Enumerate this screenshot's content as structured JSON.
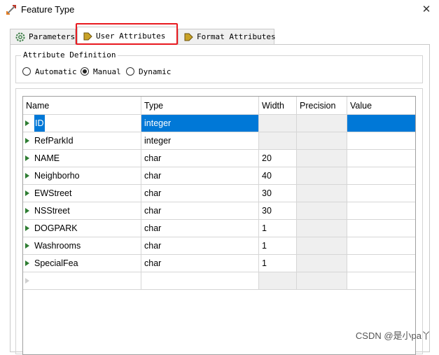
{
  "window": {
    "title": "Feature Type",
    "close_glyph": "✕",
    "title_icon": "feature-type-icon"
  },
  "tabs": [
    {
      "label": "Parameters",
      "icon": "gear-icon",
      "active": false
    },
    {
      "label": "User Attributes",
      "icon": "arrow-right-icon",
      "active": true
    },
    {
      "label": "Format Attributes",
      "icon": "arrow-right-icon",
      "active": false
    }
  ],
  "attribute_definition": {
    "title": "Attribute Definition",
    "options": [
      {
        "label": "Automatic",
        "selected": false
      },
      {
        "label": "Manual",
        "selected": true
      },
      {
        "label": "Dynamic",
        "selected": false
      }
    ]
  },
  "table": {
    "columns": [
      "Name",
      "Type",
      "Width",
      "Precision",
      "Value"
    ],
    "rows": [
      {
        "name": "ID",
        "type": "integer",
        "width": "",
        "precision": "",
        "value": ""
      },
      {
        "name": "RefParkId",
        "type": "integer",
        "width": "",
        "precision": "",
        "value": ""
      },
      {
        "name": "NAME",
        "type": "char",
        "width": "20",
        "precision": "",
        "value": ""
      },
      {
        "name": "Neighborho",
        "type": "char",
        "width": "40",
        "precision": "",
        "value": ""
      },
      {
        "name": "EWStreet",
        "type": "char",
        "width": "30",
        "precision": "",
        "value": ""
      },
      {
        "name": "NSStreet",
        "type": "char",
        "width": "30",
        "precision": "",
        "value": ""
      },
      {
        "name": "DOGPARK",
        "type": "char",
        "width": "1",
        "precision": "",
        "value": ""
      },
      {
        "name": "Washrooms",
        "type": "char",
        "width": "1",
        "precision": "",
        "value": ""
      },
      {
        "name": "SpecialFea",
        "type": "char",
        "width": "1",
        "precision": "",
        "value": ""
      }
    ],
    "selected_row": 0
  },
  "watermark": "CSDN @是小pa丫",
  "colors": {
    "selection": "#0078d7",
    "highlight_border": "#e8191f",
    "row_marker": "#2e7d32"
  }
}
